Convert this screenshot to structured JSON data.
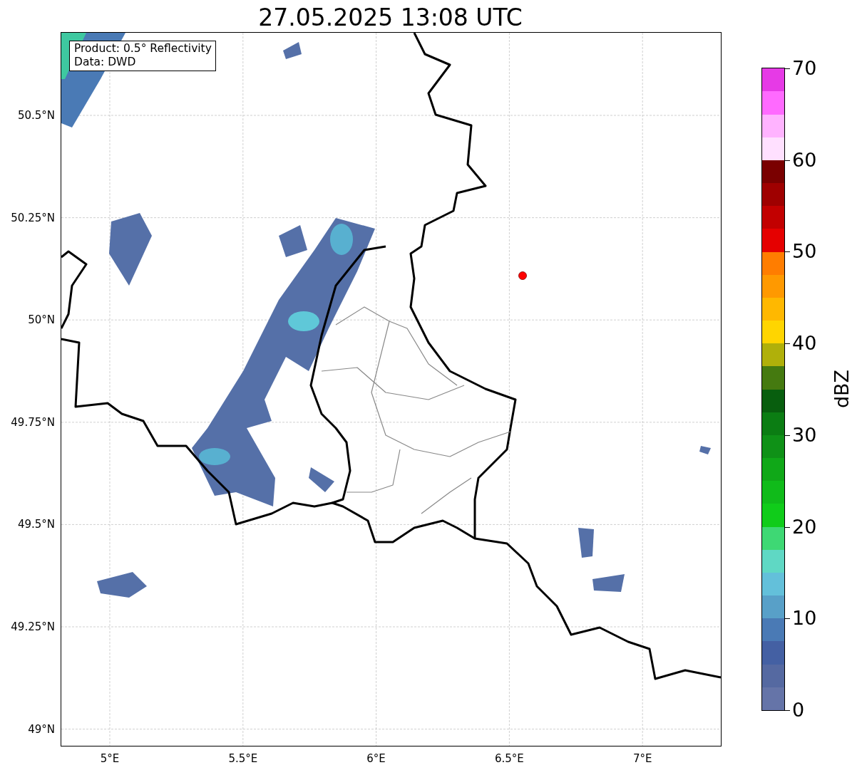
{
  "title": "27.05.2025 13:08 UTC",
  "info_box": {
    "lines": [
      "Product: 0.5° Reflectivity",
      "Data: DWD"
    ]
  },
  "map": {
    "x_ticks": [
      "5°E",
      "5.5°E",
      "6°E",
      "6.5°E",
      "7°E"
    ],
    "y_ticks": [
      "50.5°N",
      "50.25°N",
      "50°N",
      "49.75°N",
      "49.5°N",
      "49.25°N",
      "49°N"
    ]
  },
  "colorbar": {
    "label": "dBZ",
    "ticks": [
      "70",
      "60",
      "50",
      "40",
      "30",
      "20",
      "10",
      "0"
    ],
    "segments": [
      {
        "color": "#6574a8"
      },
      {
        "color": "#5569a1"
      },
      {
        "color": "#4460a3"
      },
      {
        "color": "#4a7ab5"
      },
      {
        "color": "#58a0c8"
      },
      {
        "color": "#63c0da"
      },
      {
        "color": "#5fd8c4"
      },
      {
        "color": "#3ed874"
      },
      {
        "color": "#10cc1a"
      },
      {
        "color": "#10bb1a"
      },
      {
        "color": "#10a818"
      },
      {
        "color": "#0f9117"
      },
      {
        "color": "#0b7d13"
      },
      {
        "color": "#085e0e"
      },
      {
        "color": "#457a10"
      },
      {
        "color": "#b0b00a"
      },
      {
        "color": "#ffd500"
      },
      {
        "color": "#ffb800"
      },
      {
        "color": "#ff9900"
      },
      {
        "color": "#ff7d00"
      },
      {
        "color": "#e50000"
      },
      {
        "color": "#c20000"
      },
      {
        "color": "#9f0000"
      },
      {
        "color": "#7a0000"
      },
      {
        "color": "#ffe0ff"
      },
      {
        "color": "#ffb3ff"
      },
      {
        "color": "#ff6aff"
      },
      {
        "color": "#e63ae6"
      }
    ]
  }
}
